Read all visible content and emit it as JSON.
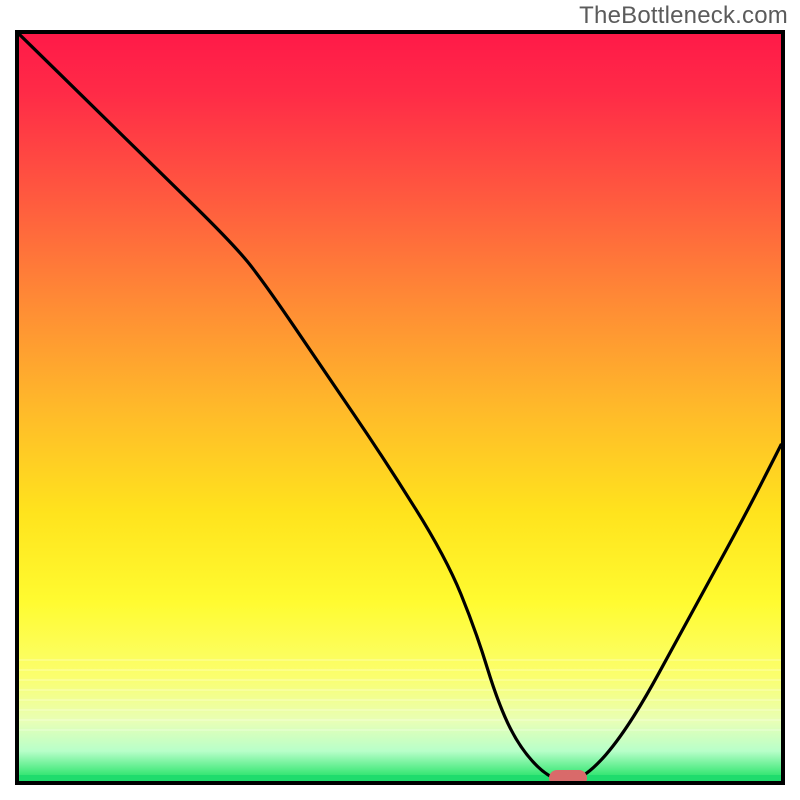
{
  "watermark": "TheBottleneck.com",
  "chart_data": {
    "type": "line",
    "title": "",
    "xlabel": "",
    "ylabel": "",
    "xlim": [
      0,
      100
    ],
    "ylim": [
      0,
      100
    ],
    "grid": false,
    "series": [
      {
        "name": "bottleneck-curve",
        "x": [
          0,
          10,
          18,
          28,
          32,
          40,
          48,
          56,
          60,
          63,
          66,
          70,
          74,
          80,
          88,
          95,
          100
        ],
        "values": [
          100,
          90,
          82,
          72,
          67,
          55,
          43,
          30,
          20,
          10,
          4,
          0,
          0,
          7,
          22,
          35,
          45
        ]
      }
    ],
    "annotations": [
      {
        "name": "optimal-marker",
        "x": 72,
        "y": 0,
        "color": "#d96a6a"
      }
    ],
    "background_gradient": {
      "stops": [
        {
          "pos": 0,
          "color": "#ff1a48"
        },
        {
          "pos": 50,
          "color": "#ffb92a"
        },
        {
          "pos": 76,
          "color": "#fffb30"
        },
        {
          "pos": 96,
          "color": "#b8ffc9"
        },
        {
          "pos": 100,
          "color": "#1ed96b"
        }
      ]
    }
  }
}
